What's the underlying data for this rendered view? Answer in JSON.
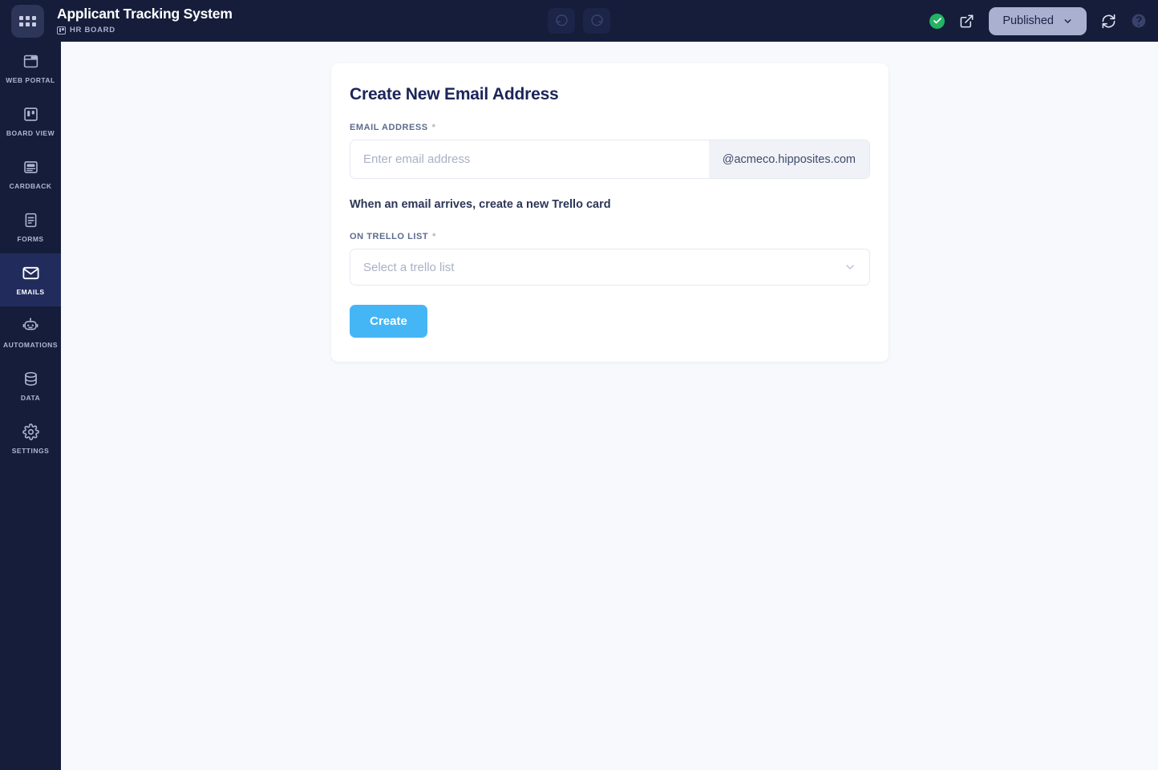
{
  "header": {
    "app_title": "Applicant Tracking System",
    "board_subtitle": "HR BOARD",
    "logo_icon": "apps-grid-icon",
    "board_icon": "trello-board-icon",
    "undo_icon": "undo-icon",
    "redo_icon": "redo-icon",
    "saved_icon": "check-circle-icon",
    "open_external_icon": "external-link-icon",
    "status_label": "Published",
    "status_chevron_icon": "chevron-down-icon",
    "sync_icon": "sync-refresh-icon",
    "help_icon": "help-circle-icon",
    "accent_navy": "#151d3b",
    "status_pill_color": "#a9b0d0",
    "saved_color": "#24b263"
  },
  "sidebar": {
    "items": [
      {
        "label": "WEB PORTAL",
        "icon": "browser-window-icon",
        "active": false
      },
      {
        "label": "BOARD VIEW",
        "icon": "board-columns-icon",
        "active": false
      },
      {
        "label": "CARDBACK",
        "icon": "card-back-icon",
        "active": false
      },
      {
        "label": "FORMS",
        "icon": "form-document-icon",
        "active": false
      },
      {
        "label": "EMAILS",
        "icon": "envelope-icon",
        "active": true
      },
      {
        "label": "AUTOMATIONS",
        "icon": "robot-icon",
        "active": false
      },
      {
        "label": "DATA",
        "icon": "database-icon",
        "active": false
      },
      {
        "label": "SETTINGS",
        "icon": "gear-icon",
        "active": false
      }
    ],
    "active_bg": "#222c5c"
  },
  "main": {
    "card_title": "Create New Email Address",
    "email_field": {
      "label": "EMAIL ADDRESS",
      "required_marker": "*",
      "value": "",
      "placeholder": "Enter email address",
      "domain_suffix": "@acmeco.hipposites.com"
    },
    "helper_text": "When an email arrives, create a new Trello card",
    "trello_field": {
      "label": "ON TRELLO LIST",
      "required_marker": "*",
      "selected": "Select a trello list",
      "chevron_icon": "chevron-down-icon"
    },
    "create_button": "Create",
    "button_color": "#45b6f5"
  }
}
